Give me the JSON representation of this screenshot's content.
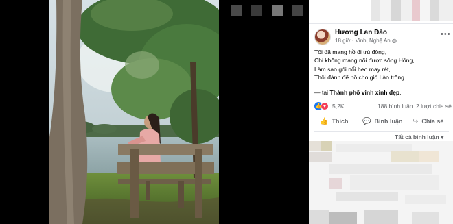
{
  "post": {
    "author": "Hương Lan Đào",
    "time": "18 giờ",
    "location_meta": "Vinh, Nghệ An",
    "lines": [
      "Tôi đã mang hồ đi trú đông,",
      "Chỉ không mang nổi được sông Hồng,",
      "Làm sao gói nổi heo may rét,",
      "Thôi đành để hồ cho gió Lào trông."
    ],
    "location_prefix": "— tại",
    "location_name": "Thành phố vinh xinh đẹp",
    "location_suffix": "."
  },
  "stats": {
    "reactions": "5,2K",
    "comments": "188 bình luận",
    "shares": "2 lượt chia sẻ"
  },
  "actions": {
    "like": "Thích",
    "comment": "Bình luận",
    "share": "Chia sẻ"
  },
  "sort_label": "Tất cả bình luận",
  "icons": {
    "more": "more-icon",
    "globe": "globe-icon",
    "like": "like-icon",
    "comment": "comment-icon",
    "share": "share-icon",
    "dropdown": "chevron-down-icon"
  },
  "colors": {
    "facebook_blue": "#1877f2",
    "love_red": "#f33e58",
    "secondary_text": "#65676b"
  }
}
